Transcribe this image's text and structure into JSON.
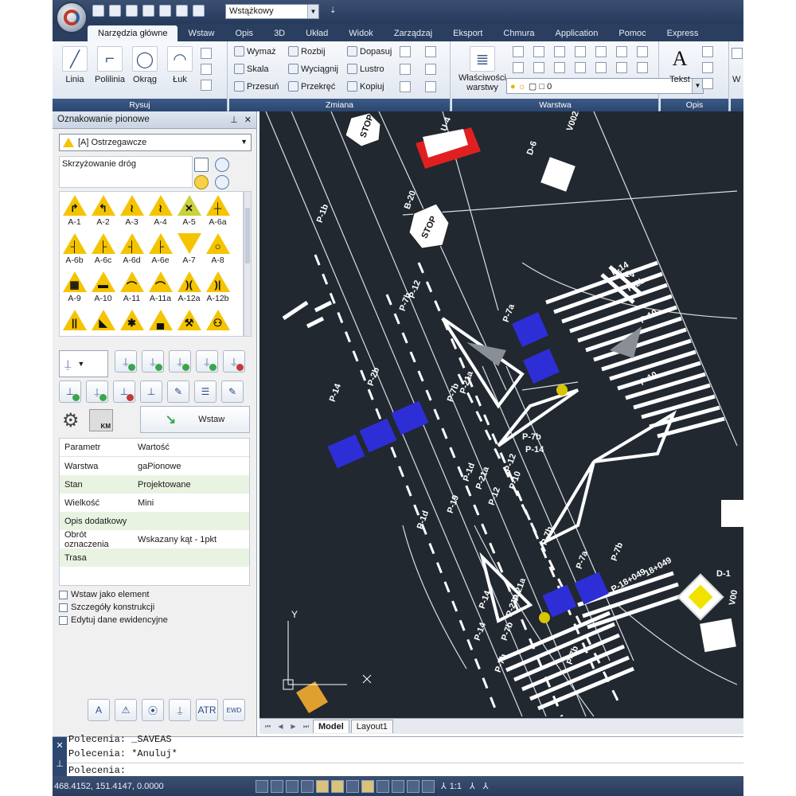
{
  "quick_access": {
    "workspace": "Wstążkowy"
  },
  "tabs": [
    {
      "label": "Narzędzia główne"
    },
    {
      "label": "Wstaw"
    },
    {
      "label": "Opis"
    },
    {
      "label": "3D"
    },
    {
      "label": "Układ"
    },
    {
      "label": "Widok"
    },
    {
      "label": "Zarządzaj"
    },
    {
      "label": "Eksport"
    },
    {
      "label": "Chmura"
    },
    {
      "label": "Application"
    },
    {
      "label": "Pomoc"
    },
    {
      "label": "Express"
    }
  ],
  "ribbon": {
    "draw": {
      "label": "Rysuj",
      "linia": "Linia",
      "polilinia": "Polilinia",
      "okrag": "Okrąg",
      "luk": "Łuk"
    },
    "modify": {
      "label": "Zmiana",
      "wymaz": "Wymaż",
      "rozbij": "Rozbij",
      "dopasuj": "Dopasuj",
      "skala": "Skala",
      "wyciagnij": "Wyciągnij",
      "lustro": "Lustro",
      "przesun": "Przesuń",
      "przekrec": "Przekręć",
      "kopiuj": "Kopiuj"
    },
    "layer": {
      "label": "Warstwa",
      "properties": "Właściwości",
      "properties2": "warstwy",
      "current": "0"
    },
    "annot": {
      "label": "Opis",
      "tekst": "Tekst"
    },
    "more": "W"
  },
  "panel": {
    "title": "Oznakowanie pionowe",
    "category": "[A] Ostrzegawcze",
    "search": "Skrzyżowanie dróg",
    "signs": [
      "A-1",
      "A-2",
      "A-3",
      "A-4",
      "A-5",
      "A-6a",
      "A-6b",
      "A-6c",
      "A-6d",
      "A-6e",
      "A-7",
      "A-8",
      "A-9",
      "A-10",
      "A-11",
      "A-11a",
      "A-12a",
      "A-12b",
      "",
      "",
      "",
      "",
      "",
      ""
    ],
    "insert": "Wstaw",
    "params_header": {
      "k": "Parametr",
      "v": "Wartość"
    },
    "params": [
      {
        "k": "Warstwa",
        "v": "gaPionowe"
      },
      {
        "k": "Stan",
        "v": "Projektowane"
      },
      {
        "k": "Wielkość",
        "v": "Mini"
      },
      {
        "k": "Opis dodatkowy",
        "v": ""
      },
      {
        "k": "Obrót oznaczenia",
        "v": "Wskazany kąt - 1pkt"
      },
      {
        "k": "Trasa",
        "v": ""
      }
    ],
    "checkboxes": [
      {
        "label": "Wstaw jako element",
        "checked": false
      },
      {
        "label": "Szczegóły konstrukcji",
        "checked": false
      },
      {
        "label": "Edytuj dane ewidencyjne",
        "checked": false
      }
    ]
  },
  "drawing": {
    "labels": [
      "STOP",
      "STOP",
      "B-20",
      "U-4",
      "D-6",
      "V0028",
      "P-1b",
      "P-12",
      "P-7b",
      "P-14",
      "P-7a",
      "P-2b",
      "P-14",
      "P-10",
      "P-10",
      "P-14",
      "P-2b",
      "P-21a",
      "P-7b",
      "P-12",
      "P-10",
      "P-7b",
      "P-14",
      "P-21a",
      "P-19",
      "P-1d",
      "P-12",
      "P-1d",
      "P-7b",
      "P-21a",
      "P-7b",
      "P-14",
      "P-7b",
      "P-21a",
      "P-7a",
      "P-7b",
      "P-7b",
      "P-14",
      "D-1",
      "V00",
      "P-18+049",
      "18+049"
    ],
    "ucs_y": "Y"
  },
  "layout_tabs": [
    {
      "label": "Model"
    },
    {
      "label": "Layout1"
    }
  ],
  "command": {
    "lines": [
      "Polecenia: _SAVEAS",
      "Polecenia: *Anuluj*",
      "Polecenia:"
    ]
  },
  "status": {
    "coords": "468.4152, 151.4147, 0.0000",
    "scale": "1:1"
  },
  "colors": {
    "background": "#212830",
    "sign_yellow": "#f5c400",
    "sign_blue": "#2e2ed6",
    "ribbon_dark": "#2a3e60"
  }
}
